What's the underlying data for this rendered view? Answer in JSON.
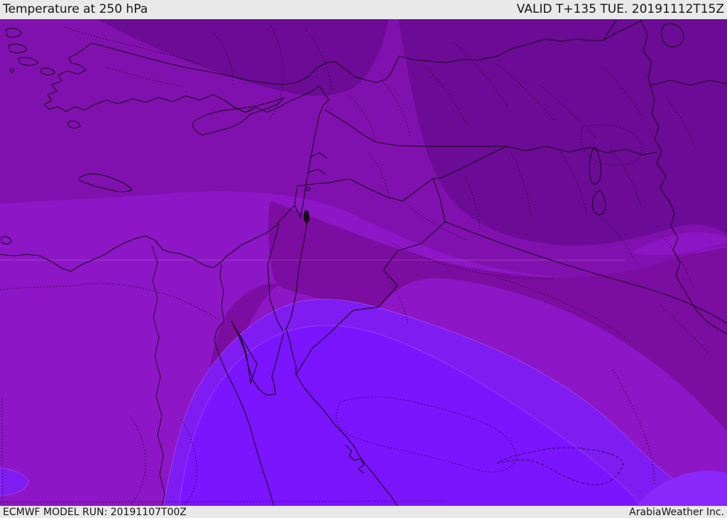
{
  "header": {
    "title": "Temperature at 250 hPa",
    "valid_label": "VALID T+135 TUE. 20191112T15Z"
  },
  "footer": {
    "model_run": "ECMWF MODEL RUN: 20191107T00Z",
    "credit": "ArabiaWeather Inc."
  },
  "map": {
    "colors": {
      "band_dark": "#6c0b95",
      "band_medium": "#8111ae",
      "band_light": "#8d16c6",
      "band_mid_dark": "#7c0da1",
      "band_bright": "#7e1cf2",
      "band_brightest": "#7b14ff",
      "band_corner_glow": "#8a27fa",
      "border_line": "#1a0a1f",
      "bar_background": "#e9e9e9",
      "bar_text": "#151515"
    }
  }
}
